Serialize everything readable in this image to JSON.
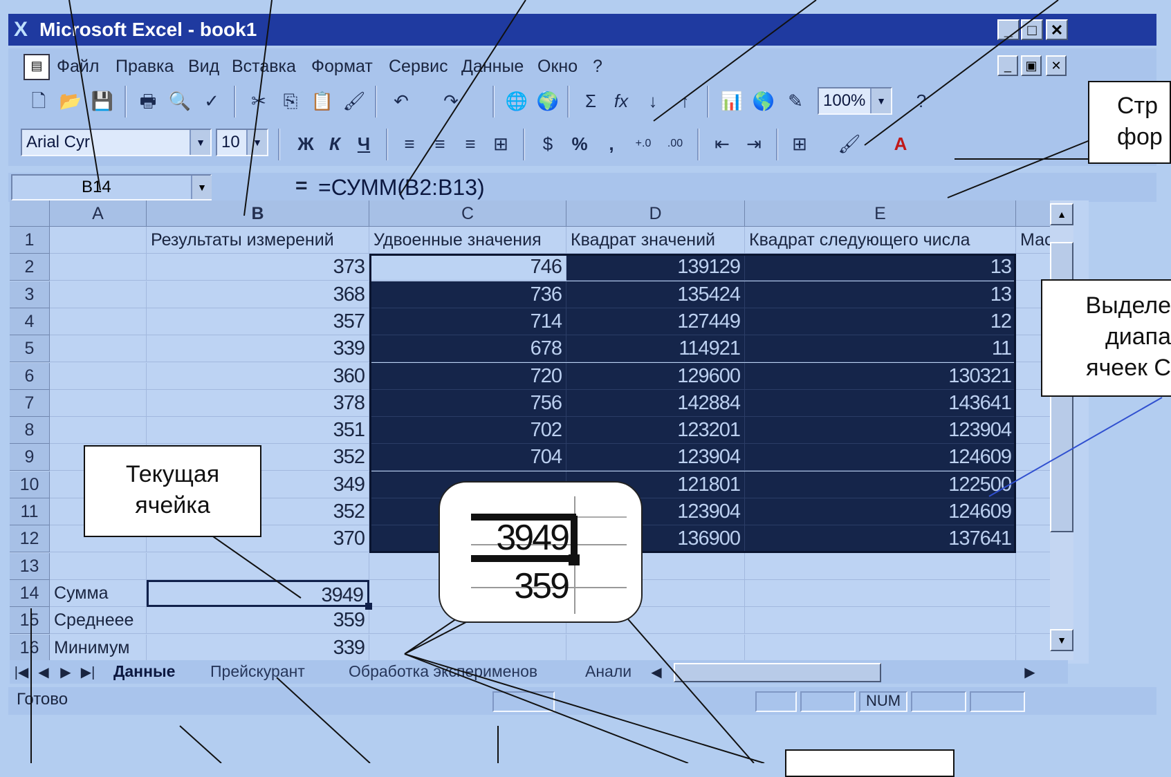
{
  "window": {
    "title": "Microsoft Excel - book1",
    "app_icon": "excel-x-icon"
  },
  "menu": {
    "items": [
      "Файл",
      "Правка",
      "Вид",
      "Вставка",
      "Формат",
      "Сервис",
      "Данные",
      "Окно",
      "?"
    ]
  },
  "toolbar_standard": {
    "zoom": "100%"
  },
  "toolbar_format": {
    "font": "Arial Cyr",
    "size": "10",
    "bold": "Ж",
    "italic": "К",
    "underline": "Ч",
    "percent": "%",
    "comma": ","
  },
  "formula_bar": {
    "name_box": "B14",
    "equals": "=",
    "formula": "=СУММ(B2:B13)"
  },
  "columns": [
    "A",
    "B",
    "C",
    "D",
    "E"
  ],
  "headers_row": {
    "B": "Результаты измерений",
    "C": "Удвоенные значения",
    "D": "Квадрат значений",
    "E": "Квадрат следующего числа",
    "F": "Мас"
  },
  "rows": [
    {
      "n": "1"
    },
    {
      "n": "2",
      "B": "373",
      "C": "746",
      "D": "139129",
      "E": "13"
    },
    {
      "n": "3",
      "B": "368",
      "C": "736",
      "D": "135424",
      "E": "13"
    },
    {
      "n": "4",
      "B": "357",
      "C": "714",
      "D": "127449",
      "E": "12"
    },
    {
      "n": "5",
      "B": "339",
      "C": "678",
      "D": "114921",
      "E": "11"
    },
    {
      "n": "6",
      "B": "360",
      "C": "720",
      "D": "129600",
      "E": "130321"
    },
    {
      "n": "7",
      "B": "378",
      "C": "756",
      "D": "142884",
      "E": "143641"
    },
    {
      "n": "8",
      "B": "351",
      "C": "702",
      "D": "123201",
      "E": "123904"
    },
    {
      "n": "9",
      "B": "352",
      "C": "704",
      "D": "123904",
      "E": "124609"
    },
    {
      "n": "10",
      "B": "349",
      "C": "",
      "D": "121801",
      "E": "122500"
    },
    {
      "n": "11",
      "B": "352",
      "C": "",
      "D": "123904",
      "E": "124609"
    },
    {
      "n": "12",
      "B": "370",
      "C": "",
      "D": "136900",
      "E": "137641"
    },
    {
      "n": "13"
    },
    {
      "n": "14",
      "A": "Сумма",
      "B": "3949"
    },
    {
      "n": "15",
      "A": "Среднеее",
      "B": "359"
    },
    {
      "n": "16",
      "A": "Минимум",
      "B": "339"
    }
  ],
  "sheet_tabs": [
    "Данные",
    "Прейскурант",
    "Обработка эксперименов",
    "Анали"
  ],
  "status": {
    "text": "Готово",
    "num": "NUM"
  },
  "callouts": {
    "current_cell": [
      "Текущая",
      "ячейка"
    ],
    "format_bar": [
      "Стр",
      "фор"
    ],
    "selected": [
      "Выделе",
      "диапа",
      "ячеек С"
    ],
    "zoom_top": "3949",
    "zoom_bottom": "359"
  }
}
